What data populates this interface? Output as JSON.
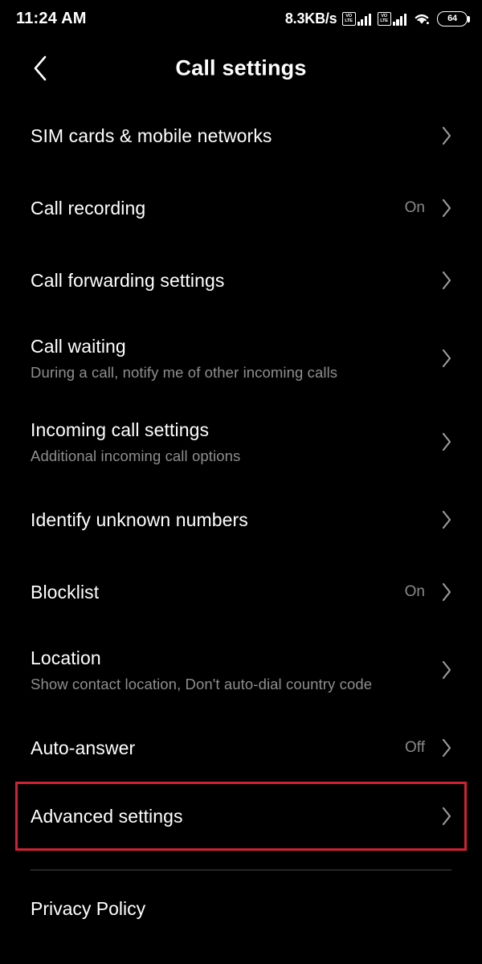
{
  "status_bar": {
    "time": "11:24 AM",
    "network_speed": "8.3KB/s",
    "sim1_volte_top": "VO",
    "sim1_volte_bottom": "LTE",
    "sim2_volte_top": "VO",
    "sim2_volte_bottom": "LTE",
    "battery_percent": "64",
    "icons": [
      "volte-icon",
      "signal-bars-icon",
      "volte-icon",
      "signal-bars-icon",
      "wifi-icon",
      "battery-icon"
    ]
  },
  "header": {
    "title": "Call settings",
    "back_icon": "chevron-left-icon"
  },
  "colors": {
    "background": "#000000",
    "title_text": "#ffffff",
    "subtitle_text": "#8e8e8e",
    "value_text": "#8a8a8a",
    "chevron": "#9a9a9a",
    "highlight_border": "#cf2233",
    "divider": "#262626"
  },
  "list": {
    "items": [
      {
        "title": "SIM cards & mobile networks",
        "subtitle": "",
        "value": "",
        "highlighted": false
      },
      {
        "title": "Call recording",
        "subtitle": "",
        "value": "On",
        "highlighted": false
      },
      {
        "title": "Call forwarding settings",
        "subtitle": "",
        "value": "",
        "highlighted": false
      },
      {
        "title": "Call waiting",
        "subtitle": "During a call, notify me of other incoming calls",
        "value": "",
        "highlighted": false
      },
      {
        "title": "Incoming call settings",
        "subtitle": "Additional incoming call options",
        "value": "",
        "highlighted": false
      },
      {
        "title": "Identify unknown numbers",
        "subtitle": "",
        "value": "",
        "highlighted": false
      },
      {
        "title": "Blocklist",
        "subtitle": "",
        "value": "On",
        "highlighted": false
      },
      {
        "title": "Location",
        "subtitle": "Show contact location, Don't auto-dial country code",
        "value": "",
        "highlighted": false
      },
      {
        "title": "Auto-answer",
        "subtitle": "",
        "value": "Off",
        "highlighted": false
      },
      {
        "title": "Advanced settings",
        "subtitle": "",
        "value": "",
        "highlighted": true
      }
    ]
  },
  "footer": {
    "privacy_policy_label": "Privacy Policy"
  }
}
